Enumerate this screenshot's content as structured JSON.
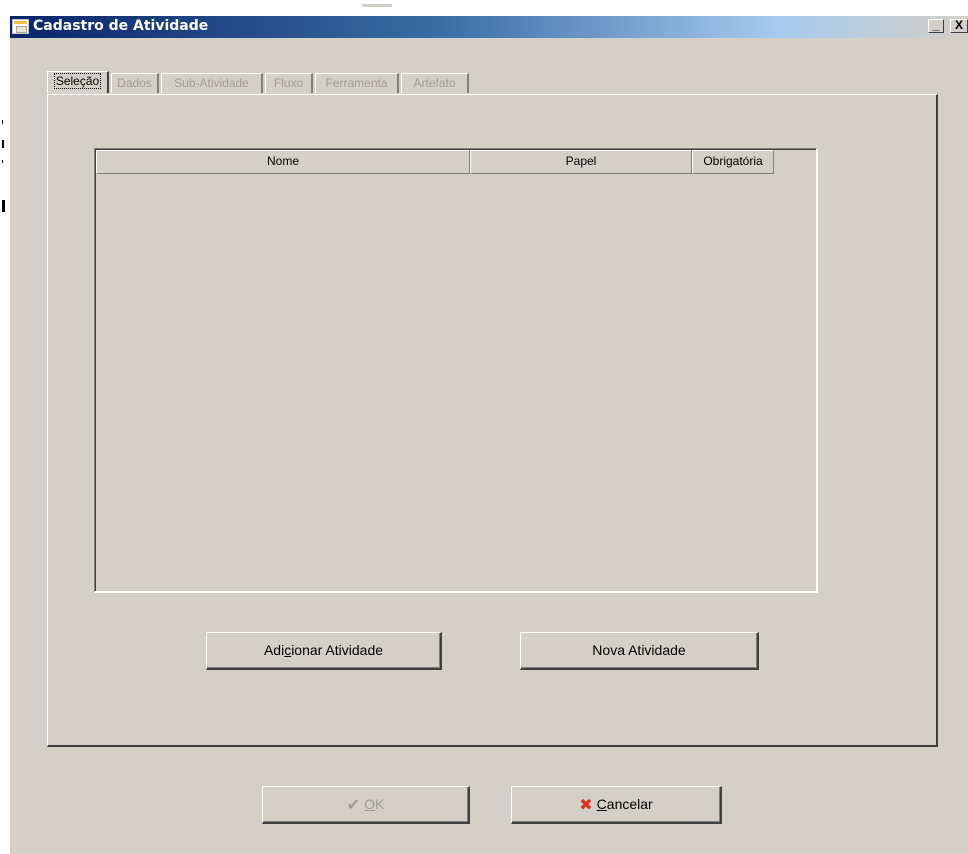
{
  "window": {
    "title": "Cadastro de Atividade",
    "minimize_glyph": "_",
    "close_glyph": "X"
  },
  "tabs": [
    {
      "label": "Seleção",
      "active": true,
      "enabled": true
    },
    {
      "label": "Dados",
      "active": false,
      "enabled": false
    },
    {
      "label": "Sub-Atividade",
      "active": false,
      "enabled": false
    },
    {
      "label": "Fluxo",
      "active": false,
      "enabled": false
    },
    {
      "label": "Ferramenta",
      "active": false,
      "enabled": false
    },
    {
      "label": "Artefato",
      "active": false,
      "enabled": false
    }
  ],
  "grid": {
    "columns": [
      "Nome",
      "Papel",
      "Obrigatória"
    ],
    "rows": []
  },
  "buttons": {
    "add_activity": {
      "label_pre": "Adi",
      "label_hot": "c",
      "label_post": "ionar Atividade"
    },
    "new_activity": {
      "label": "Nova Atividade"
    },
    "ok": {
      "icon": "check-icon",
      "label_hot": "O",
      "label_post": "K",
      "enabled": false
    },
    "cancel": {
      "icon": "red-x-icon",
      "label_hot": "C",
      "label_post": "ancelar",
      "enabled": true
    }
  },
  "colors": {
    "face": "#d4d0c8",
    "title_start": "#0a246a",
    "title_end": "#a6caf0",
    "disabled_text": "#a09c94",
    "cancel_icon": "#e03020"
  }
}
